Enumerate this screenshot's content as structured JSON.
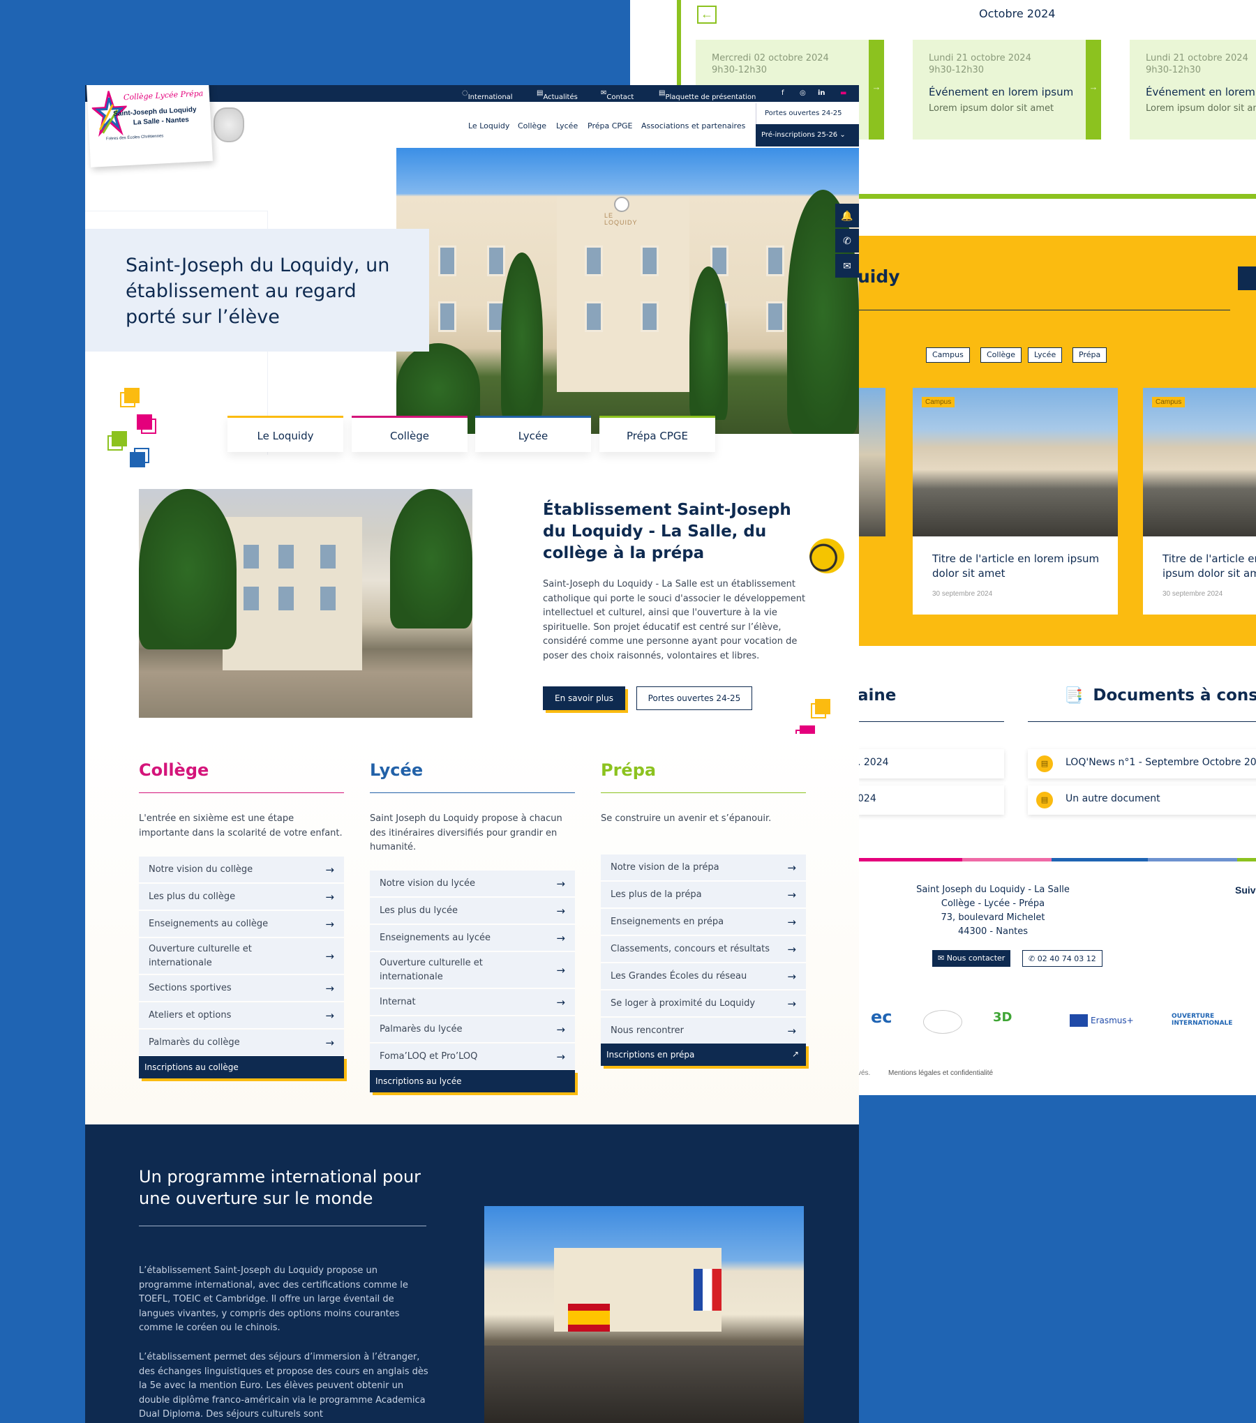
{
  "back": {
    "month": "Octobre 2024",
    "events": [
      {
        "date": "Mercredi 02 octobre 2024",
        "time": "9h30-12h30",
        "title": "",
        "sub": ""
      },
      {
        "date": "Lundi 21 octobre 2024",
        "time": "9h30-12h30",
        "title": "Événement en lorem ipsum",
        "sub": "Lorem ipsum dolor sit amet"
      },
      {
        "date": "Lundi 21 octobre 2024",
        "time": "9h30-12h30",
        "title": "Événement en lorem i",
        "sub": "Lorem ipsum dolor sit am"
      }
    ],
    "news_title": "uidy",
    "filters": [
      "Campus",
      "Collège",
      "Lycée",
      "Prépa"
    ],
    "cards": [
      {
        "tag": "Campus",
        "title": "Titre de l'article en lorem ipsum dolor sit amet",
        "date": "30 septembre 2024"
      },
      {
        "tag": "Campus",
        "title": "Titre de l'article en ipsum dolor sit am",
        "date": "30 septembre 2024"
      }
    ],
    "agenda_title": "aine",
    "agenda_items": [
      ". 2024",
      "024"
    ],
    "docs_title": "Documents à consulter",
    "docs": [
      "LOQ'News n°1 - Septembre Octobre 2024",
      "Un autre document"
    ],
    "footer": {
      "addr": [
        "Saint Joseph du Loquidy - La Salle",
        "Collège - Lycée - Prépa",
        "73, boulevard Michelet",
        "44300 - Nantes"
      ],
      "contact_btn": "Nous contacter",
      "phone_btn": "02 40 74 03 12",
      "follow": "Suiv",
      "legal": "Mentions légales et confidentialité",
      "legal_prefix": "vés.",
      "logos": [
        "ec",
        "3D",
        "Erasmus+",
        "OUVERTURE INTERNATIONALE"
      ]
    }
  },
  "front": {
    "topbar": [
      "International",
      "Actualités",
      "Contact",
      "Plaquette de présentation"
    ],
    "logo": {
      "line1": "Collège  Lycée  Prépa",
      "line2": "Saint-Joseph du Loquidy",
      "line3": "La Salle - Nantes",
      "line4": "Frères des Écoles Chrétiennes"
    },
    "nav": [
      "Le Loquidy",
      "Collège",
      "Lycée",
      "Prépa CPGE",
      "Associations et partenaires"
    ],
    "portes": "Portes ouvertes 24-25",
    "preins": "Pré-inscriptions 25-26",
    "hero_title": "Saint-Joseph du Loquidy, un établissement au regard porté sur l’élève",
    "tabs": [
      "Le Loquidy",
      "Collège",
      "Lycée",
      "Prépa CPGE"
    ],
    "intro_title": "Établissement Saint-Joseph du Loquidy - La Salle, du collège à la prépa",
    "intro_text": "Saint-Joseph du Loquidy - La Salle est un établissement catholique qui porte le souci d'associer le développement intellectuel et culturel, ainsi que l'ouverture à la vie spirituelle. Son projet éducatif est centré sur l’élève, considéré comme une personne ayant pour vocation de poser des choix raisonnés, volontaires et libres.",
    "btn_more": "En savoir plus",
    "btn_portes": "Portes ouvertes 24-25",
    "columns": [
      {
        "title": "Collège",
        "color": "#d4147a",
        "text": "L'entrée en sixième est une étape importante dans la scolarité de votre enfant.",
        "items": [
          "Notre vision du collège",
          "Les plus du collège",
          "Enseignements au collège",
          "Ouverture culturelle et internationale",
          "Sections sportives",
          "Ateliers et options",
          "Palmarès du collège"
        ],
        "cta": "Inscriptions au collège"
      },
      {
        "title": "Lycée",
        "color": "#2261a8",
        "text": "Saint Joseph du Loquidy propose à chacun des itinéraires diversifiés pour grandir en humanité.",
        "items": [
          "Notre vision du lycée",
          "Les plus du lycée",
          "Enseignements au lycée",
          "Ouverture culturelle et internationale",
          "Internat",
          "Palmarès du lycée",
          "Foma’LOQ et Pro’LOQ"
        ],
        "cta": "Inscriptions au lycée"
      },
      {
        "title": "Prépa",
        "color": "#8cc21f",
        "text": "Se construire un avenir et s’épanouir.",
        "items": [
          "Notre vision de la prépa",
          "Les plus de la prépa",
          "Enseignements en prépa",
          "Classements, concours et résultats",
          "Les Grandes Écoles du réseau",
          "Se loger à proximité du Loquidy",
          "Nous rencontrer"
        ],
        "cta": "Inscriptions en prépa"
      }
    ],
    "intl_title": "Un programme international pour une ouverture sur le monde",
    "intl_p1": "L’établissement Saint-Joseph du Loquidy propose un programme international, avec des certifications comme le TOEFL, TOEIC et Cambridge. Il offre un large éventail de langues vivantes, y compris des options moins courantes comme le coréen ou le chinois.",
    "intl_p2": "L’établissement permet des séjours d’immersion à l’étranger, des échanges linguistiques et propose des cours en anglais dès la 5e avec la mention Euro. Les élèves peuvent obtenir un double diplôme franco-américain via le programme Academica Dual Diploma. Des séjours culturels sont"
  }
}
